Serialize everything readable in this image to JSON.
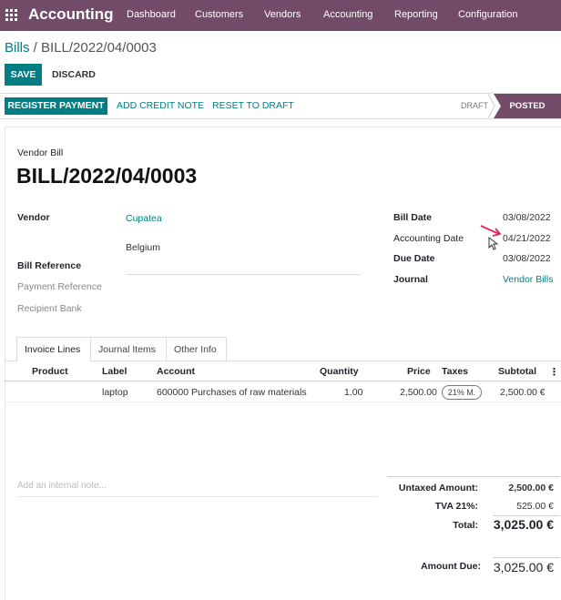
{
  "topbar": {
    "app_title": "Accounting",
    "menu": [
      "Dashboard",
      "Customers",
      "Vendors",
      "Accounting",
      "Reporting",
      "Configuration"
    ]
  },
  "breadcrumb": {
    "parent": "Bills",
    "separator": " / ",
    "current": "BILL/2022/04/0003"
  },
  "actions": {
    "save": "SAVE",
    "discard": "DISCARD"
  },
  "toolbar": {
    "register_payment": "REGISTER PAYMENT",
    "add_credit_note": "ADD CREDIT NOTE",
    "reset_to_draft": "RESET TO DRAFT",
    "status_draft": "DRAFT",
    "status_posted": "POSTED"
  },
  "header": {
    "doc_type": "Vendor Bill",
    "doc_number": "BILL/2022/04/0003"
  },
  "left_fields": {
    "vendor_label": "Vendor",
    "vendor_name": "Cupatea",
    "vendor_country": "Belgium",
    "bill_reference_label": "Bill Reference",
    "payment_reference_label": "Payment Reference",
    "recipient_bank_label": "Recipient Bank"
  },
  "right_fields": {
    "bill_date_label": "Bill Date",
    "bill_date": "03/08/2022",
    "accounting_date_label": "Accounting Date",
    "accounting_date": "04/21/2022",
    "due_date_label": "Due Date",
    "due_date": "03/08/2022",
    "journal_label": "Journal",
    "journal": "Vendor Bills"
  },
  "tabs": [
    "Invoice Lines",
    "Journal Items",
    "Other Info"
  ],
  "table": {
    "columns": [
      "Product",
      "Label",
      "Account",
      "Quantity",
      "Price",
      "Taxes",
      "Subtotal"
    ],
    "rows": [
      {
        "product": "",
        "label": "laptop",
        "account": "600000 Purchases of raw materials",
        "quantity": "1.00",
        "price": "2,500.00",
        "taxes": "21% M.",
        "subtotal": "2,500.00 €"
      }
    ]
  },
  "note_placeholder": "Add an internal note...",
  "totals": {
    "untaxed_label": "Untaxed Amount:",
    "untaxed_value": "2,500.00 €",
    "tva_label": "TVA 21%:",
    "tva_value": "525.00 €",
    "total_label": "Total:",
    "total_value": "3,025.00 €",
    "amount_due_label": "Amount Due:",
    "amount_due_value": "3,025.00 €"
  },
  "colors": {
    "brand": "#714b67",
    "accent": "#017e84",
    "annotation_arrow": "#e0245e"
  }
}
